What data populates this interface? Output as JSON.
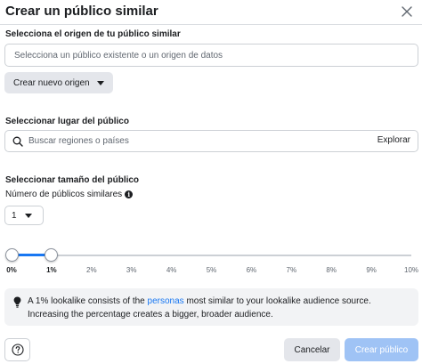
{
  "dialog": {
    "title": "Crear un público similar",
    "close_icon": "close-icon"
  },
  "source": {
    "label": "Selecciona el origen de tu público similar",
    "placeholder": "Selecciona un público existente o un origen de datos",
    "create_button": "Crear nuevo origen"
  },
  "location": {
    "label": "Seleccionar lugar del público",
    "placeholder": "Buscar regiones o países",
    "explore_button": "Explorar",
    "icon": "search-icon"
  },
  "size": {
    "label": "Seleccionar tamaño del público",
    "count_label": "Número de públicos similares",
    "count_info_icon": "info-icon",
    "count_value": "1",
    "slider": {
      "range_start": "0%",
      "range_end": "1%",
      "ticks": [
        "0%",
        "1%",
        "2%",
        "3%",
        "4%",
        "5%",
        "6%",
        "7%",
        "8%",
        "9%",
        "10%"
      ],
      "active_ticks": [
        0,
        1
      ]
    }
  },
  "info": {
    "icon": "lightbulb-icon",
    "text_before": "A 1% lookalike consists of the ",
    "link_text": "personas",
    "text_after": " most similar to your lookalike audience source. Increasing the percentage creates a bigger, broader audience."
  },
  "footer": {
    "help_icon": "help-icon",
    "cancel_button": "Cancelar",
    "create_button": "Crear público"
  },
  "colors": {
    "accent": "#1877f2",
    "disabled_primary": "#9fc3f5",
    "button_gray": "#e4e6eb",
    "border": "#ccd0d5"
  }
}
